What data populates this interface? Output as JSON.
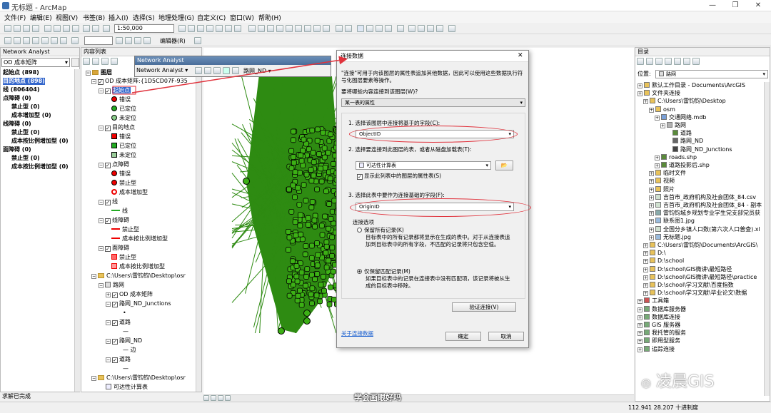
{
  "window": {
    "title": "无标题 - ArcMap"
  },
  "menu": [
    "文件(F)",
    "编辑(E)",
    "视图(V)",
    "书签(B)",
    "插入(I)",
    "选择(S)",
    "地理处理(G)",
    "自定义(C)",
    "窗口(W)",
    "帮助(H)"
  ],
  "toolbar": {
    "scale": "1:50,000",
    "editor": "编辑器(R)"
  },
  "na_panel": {
    "title": "Network Analyst",
    "dropdown": "OD 成本矩阵",
    "items": [
      {
        "label": "起始点 (898)",
        "bold": true,
        "indent": 0
      },
      {
        "label": "目的地点 (898)",
        "bold": true,
        "indent": 0,
        "selected": true
      },
      {
        "label": "线 (806404)",
        "bold": true,
        "indent": 0
      },
      {
        "label": "点障碍 (0)",
        "bold": true,
        "indent": 0
      },
      {
        "label": "禁止型 (0)",
        "bold": true,
        "indent": 1
      },
      {
        "label": "成本增加型 (0)",
        "bold": true,
        "indent": 1
      },
      {
        "label": "线障碍 (0)",
        "bold": true,
        "indent": 0
      },
      {
        "label": "禁止型 (0)",
        "bold": true,
        "indent": 1
      },
      {
        "label": "成本按比例增加型 (0)",
        "bold": true,
        "indent": 1
      },
      {
        "label": "面障碍 (0)",
        "bold": true,
        "indent": 0
      },
      {
        "label": "禁止型 (0)",
        "bold": true,
        "indent": 1
      },
      {
        "label": "成本按比例增加型 (0)",
        "bold": true,
        "indent": 1
      }
    ]
  },
  "toc": {
    "title": "内容列表",
    "layers": "图层",
    "od_layer": "OD 成本矩阵:{1D5CD07F-935",
    "origin": "起始点",
    "legend1": [
      "错误",
      "已定位",
      "未定位"
    ],
    "dest": "目的地点",
    "legend2": [
      "错误",
      "已定位",
      "未定位"
    ],
    "pointbar": "点障碍",
    "legend3": [
      "错误",
      "禁止型",
      "成本增加型"
    ],
    "line": "线",
    "line_sym": "线",
    "linebar": "线障碍",
    "legend4": [
      "禁止型",
      "成本按比例增加型"
    ],
    "polybar": "面障碍",
    "legend5": [
      "禁止型",
      "成本按比例增加型"
    ],
    "osm_path": "C:\\Users\\雷钧钧\\Desktop\\osr",
    "roadnet": "路网",
    "od_cost": "OD 成本矩阵",
    "junctions": "路网_ND_Junctions",
    "road": "道路",
    "nd": "路网_ND",
    "edge": "边",
    "road2": "道路",
    "osm_path2": "C:\\Users\\雷钧钧\\Desktop\\osr",
    "table": "可达性计算表"
  },
  "na_toolbar": {
    "title": "Network Analyst",
    "label": "Network Analyst",
    "net": "路网_ND"
  },
  "dialog": {
    "title": "连接数据",
    "desc": "\"连接\"可用于向该图层的属性表追加其他数据，因此可以使用这些数据执行符号化图层要素等操作。",
    "q": "要将哪些内容连接到该图层(W)?",
    "join_type": "某一表的属性",
    "step1": "1. 选择该图层中连接将基于的字段(C):",
    "field1": "ObjectID",
    "step2": "2. 选择要连接到此图层的表，或者从磁盘加载表(T):",
    "table": "可达性计算表",
    "show_attr": "显示此列表中的图层的属性表(S)",
    "step3": "3. 选择此表中要作为连接基础的字段(F):",
    "field3": "OriginID",
    "opts": "连接选项",
    "opt1": "保留所有记录(K)",
    "opt1_desc": "目标表中的所有记录都将显示在生成的表中。对于从连接表追加到目标表中的所有字段，不匹配的记录将只包含空值。",
    "opt2": "仅保留匹配记录(M)",
    "opt2_desc": "如果目标表中的记录在连接表中没有匹配项，该记录将被从生成的目标表中移除。",
    "validate": "验证连接(V)",
    "about": "关于连接数据",
    "ok": "确定",
    "cancel": "取消"
  },
  "catalog": {
    "title": "目录",
    "location_label": "位置:",
    "location": "路网",
    "items": [
      {
        "label": "默认工作目录 - Documents\\ArcGIS",
        "indent": 0,
        "icon": "folder-icon"
      },
      {
        "label": "文件夹连接",
        "indent": 0,
        "icon": "folder-icon"
      },
      {
        "label": "C:\\Users\\雷钧钧\\Desktop",
        "indent": 1,
        "icon": "folder-icon"
      },
      {
        "label": "osm",
        "indent": 2,
        "icon": "folder-icon"
      },
      {
        "label": "交通网络.mdb",
        "indent": 3,
        "icon": "database-icon"
      },
      {
        "label": "路网",
        "indent": 4,
        "icon": "dataset-icon"
      },
      {
        "label": "道路",
        "indent": 5,
        "icon": "line-icon"
      },
      {
        "label": "路网_ND",
        "indent": 5,
        "icon": "network-icon"
      },
      {
        "label": "路网_ND_Junctions",
        "indent": 5,
        "icon": "point-icon"
      },
      {
        "label": "roads.shp",
        "indent": 3,
        "icon": "line-icon"
      },
      {
        "label": "道路投影后.shp",
        "indent": 3,
        "icon": "line-icon"
      },
      {
        "label": "临时文件",
        "indent": 2,
        "icon": "folder-icon"
      },
      {
        "label": "视频",
        "indent": 2,
        "icon": "folder-icon"
      },
      {
        "label": "照片",
        "indent": 2,
        "icon": "folder-icon"
      },
      {
        "label": "吉首市_政府机构及社会团体_84.csv",
        "indent": 2,
        "icon": "table-icon"
      },
      {
        "label": "吉首市_政府机构及社会团体_84 - 副本",
        "indent": 2,
        "icon": "table-icon"
      },
      {
        "label": "雷钧钧城乡规划专业学生党支部党员获",
        "indent": 2,
        "icon": "doc-icon"
      },
      {
        "label": "联系图1.jpg",
        "indent": 2,
        "icon": "image-icon"
      },
      {
        "label": "全国分乡镇人口数(第六次人口普查).xl",
        "indent": 2,
        "icon": "table-icon"
      },
      {
        "label": "无标题.jpg",
        "indent": 2,
        "icon": "image-icon"
      },
      {
        "label": "C:\\Users\\雷钧钧\\Documents\\ArcGIS\\",
        "indent": 1,
        "icon": "folder-icon"
      },
      {
        "label": "D:\\",
        "indent": 1,
        "icon": "folder-icon"
      },
      {
        "label": "D:\\school",
        "indent": 1,
        "icon": "folder-icon"
      },
      {
        "label": "D:\\school\\GIS微讲\\最短路径",
        "indent": 1,
        "icon": "folder-icon"
      },
      {
        "label": "D:\\school\\GIS微讲\\最短路径\\practice",
        "indent": 1,
        "icon": "folder-icon"
      },
      {
        "label": "D:\\school\\学习文献\\百度指数",
        "indent": 1,
        "icon": "folder-icon"
      },
      {
        "label": "D:\\school\\学习文献\\毕业论文\\数据",
        "indent": 1,
        "icon": "folder-icon"
      },
      {
        "label": "工具箱",
        "indent": 0,
        "icon": "toolbox-icon"
      },
      {
        "label": "数据库服务器",
        "indent": 0,
        "icon": "server-icon"
      },
      {
        "label": "数据库连接",
        "indent": 0,
        "icon": "server-icon"
      },
      {
        "label": "GIS 服务器",
        "indent": 0,
        "icon": "server-icon"
      },
      {
        "label": "我托管的服务",
        "indent": 0,
        "icon": "server-icon"
      },
      {
        "label": "即用型服务",
        "indent": 0,
        "icon": "server-icon"
      },
      {
        "label": "追踪连接",
        "indent": 0,
        "icon": "server-icon"
      }
    ]
  },
  "watermark": "凌晨GIS",
  "caption": "学会画眼好吗",
  "status": {
    "left": "求解已完成",
    "coords": "112.941  28.207 十进制度"
  },
  "colors": {
    "map_green": "#2e8b12",
    "point_green": "#3cb015",
    "red": "#e0323c"
  }
}
